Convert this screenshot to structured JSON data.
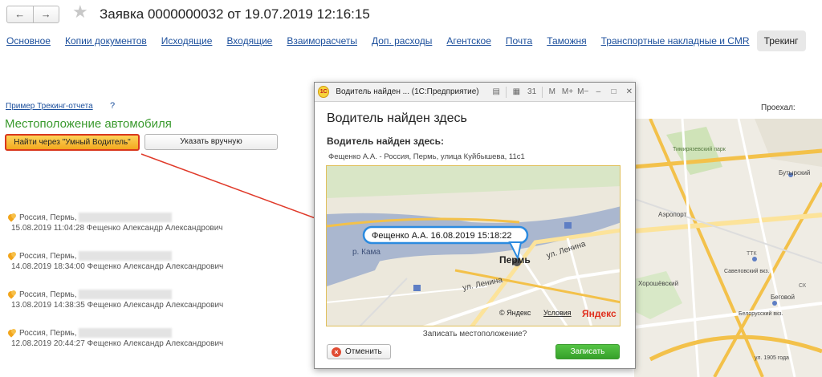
{
  "header": {
    "back_icon": "arrow-left-icon",
    "forward_icon": "arrow-right-icon",
    "back_glyph": "←",
    "forward_glyph": "→",
    "star_glyph": "★",
    "title": "Заявка 0000000032 от 19.07.2019 12:16:15"
  },
  "tabs": [
    {
      "label": "Основное"
    },
    {
      "label": "Копии документов"
    },
    {
      "label": "Исходящие"
    },
    {
      "label": "Входящие"
    },
    {
      "label": "Взаиморасчеты"
    },
    {
      "label": "Доп. расходы"
    },
    {
      "label": "Агентское"
    },
    {
      "label": "Почта"
    },
    {
      "label": "Таможня"
    },
    {
      "label": "Транспортные накладные и CMR"
    },
    {
      "label": "Трекинг",
      "active": true
    }
  ],
  "tracking": {
    "example_link": "Пример Трекинг-отчета",
    "help": "?",
    "section_title": "Местоположение автомобиля",
    "smart_button": "Найти через \"Умный Водитель\"",
    "manual_button": "Указать вручную",
    "traveled_label": "Проехал:"
  },
  "records": [
    {
      "place": "Россия, Пермь,",
      "date": "15.08.2019 11:04:28",
      "driver": "Фещенко Александр Александрович"
    },
    {
      "place": "Россия, Пермь,",
      "date": "14.08.2019 18:34:00",
      "driver": "Фещенко Александр Александрович"
    },
    {
      "place": "Россия, Пермь,",
      "date": "13.08.2019 14:38:35",
      "driver": "Фещенко Александр Александрович"
    },
    {
      "place": "Россия, Пермь,",
      "date": "12.08.2019 20:44:27",
      "driver": "Фещенко Александр Александрович"
    },
    {
      "place": "",
      "date": "",
      "driver": ""
    }
  ],
  "bigmap": {
    "labels": [
      "Тимирязевский парк",
      "Бутырский",
      "Аэропорт",
      "Савеловский вкз.",
      "Хорошёвский",
      "Беговой",
      "Белорусский вкз.",
      "ул. 1905 года",
      "ТТК",
      "СК"
    ]
  },
  "dialog": {
    "logo": "1С",
    "window_title": "Водитель найден ... (1С:Предприятие)",
    "toolbar": {
      "m": "M",
      "mplus": "M+",
      "mminus": "M−",
      "calendar": "31",
      "minimize": "–",
      "maximize": "□",
      "close": "✕"
    },
    "heading": "Водитель найден здесь",
    "subheading": "Водитель найден здесь:",
    "address": "Фещенко А.А. - Россия, Пермь, улица Куйбышева, 11с1",
    "map": {
      "callout": "Фещенко А.А. 16.08.2019 15:18:22",
      "city": "Пермь",
      "river": "р. Кама",
      "street1": "ул. Ленина",
      "street2": "ул. Ленина",
      "copyright": "© Яндекс",
      "terms": "Условия",
      "brand": "Яндекс"
    },
    "question": "Записать местоположение?",
    "cancel_button": "Отменить",
    "cancel_glyph": "×",
    "save_button": "Записать"
  },
  "colors": {
    "link": "#1c4f9c",
    "section_title": "#3a9a2e",
    "smart_button_border": "#d9381e",
    "save_button": "#36a02a",
    "arrow": "#e03a2a"
  }
}
